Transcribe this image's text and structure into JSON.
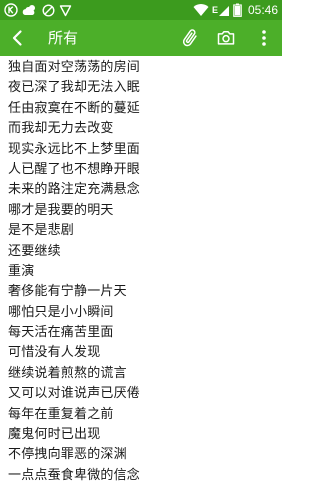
{
  "status_bar": {
    "time": "05:46",
    "left_icons": [
      "notification-k-icon",
      "weather-cloud-icon",
      "block-icon",
      "vpn-shield-icon"
    ],
    "right_icons": [
      "wifi-icon",
      "signal-e-icon",
      "battery-icon"
    ]
  },
  "app_bar": {
    "title": "所有",
    "actions": [
      "attach-icon",
      "camera-icon",
      "more-vert-icon"
    ]
  },
  "colors": {
    "status_bar": "#3c9b1e",
    "app_bar": "#4caf29",
    "text": "#1a1a1a"
  },
  "note": {
    "lines": [
      "独自面对空荡荡的房间",
      "夜已深了我却无法入眠",
      "任由寂寞在不断的蔓延",
      "而我却无力去改变",
      "现实永远比不上梦里面",
      "人已醒了也不想睁开眼",
      "未来的路注定充满悬念",
      "哪才是我要的明天",
      "是不是悲剧",
      "还要继续",
      "重演",
      "奢侈能有宁静一片天",
      "哪怕只是小小瞬间",
      "每天活在痛苦里面",
      "可惜没有人发现",
      "继续说着煎熬的谎言",
      "又可以对谁说声已厌倦",
      "每年在重复着之前",
      "魔鬼何时已出现",
      "不停拽向罪恶的深渊",
      "一点点蚕食卑微的信念"
    ]
  }
}
